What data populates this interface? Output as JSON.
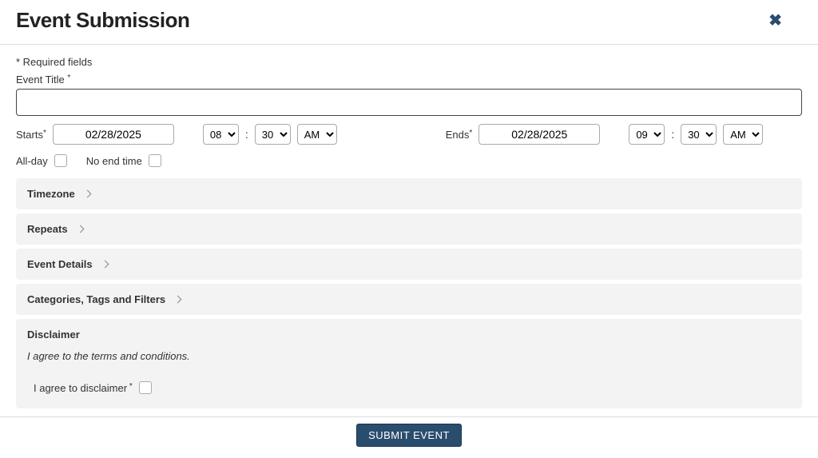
{
  "header": {
    "title": "Event Submission",
    "close_icon": "✖"
  },
  "form": {
    "required_note": "* Required fields",
    "title_label": "Event Title ",
    "title_asterisk": "*",
    "title_value": "",
    "starts_label": "Starts",
    "starts_asterisk": "*",
    "start_date": "02/28/2025",
    "start_hour": "08",
    "start_minute": "30",
    "start_ampm": "AM",
    "ends_label": "Ends",
    "ends_asterisk": "*",
    "end_date": "02/28/2025",
    "end_hour": "09",
    "end_minute": "30",
    "end_ampm": "AM",
    "colon": ":",
    "allday_label": "All-day",
    "noend_label": "No end time"
  },
  "accordion": {
    "timezone": "Timezone",
    "repeats": "Repeats",
    "details": "Event Details",
    "categories": "Categories, Tags and Filters"
  },
  "disclaimer": {
    "title": "Disclaimer",
    "text": "I agree to the terms and conditions.",
    "check_label": "I agree to disclaimer",
    "check_asterisk": " *"
  },
  "footer": {
    "submit_label": "SUBMIT EVENT"
  }
}
